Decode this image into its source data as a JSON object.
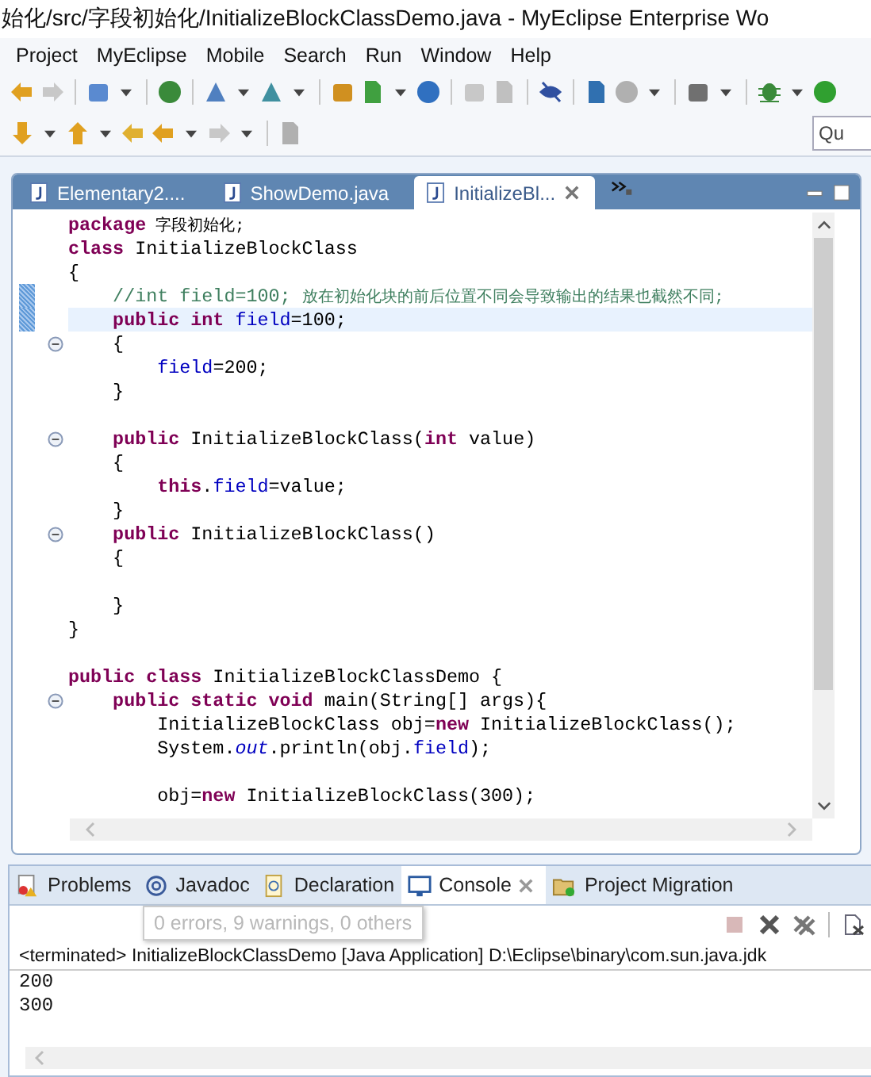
{
  "window": {
    "title": "始化/src/字段初始化/InitializeBlockClassDemo.java - MyEclipse Enterprise Wo"
  },
  "menu": [
    {
      "label": "Project"
    },
    {
      "label": "MyEclipse"
    },
    {
      "label": "Mobile"
    },
    {
      "label": "Search"
    },
    {
      "label": "Run"
    },
    {
      "label": "Window"
    },
    {
      "label": "Help"
    }
  ],
  "quick_access": {
    "placeholder": "Qu"
  },
  "editor": {
    "tabs": [
      {
        "label": "Elementary2....",
        "selected": false,
        "closable": false
      },
      {
        "label": "ShowDemo.java",
        "selected": false,
        "closable": false
      },
      {
        "label": "InitializeBl...",
        "selected": true,
        "closable": true
      }
    ],
    "lines": [
      {
        "current": false,
        "marked": false,
        "foldable": false,
        "tokens": [
          {
            "kind": "keyword",
            "text": "package"
          },
          {
            "kind": "cjk",
            "text": " 字段初始化;"
          }
        ]
      },
      {
        "current": false,
        "marked": false,
        "foldable": false,
        "tokens": [
          {
            "kind": "keyword",
            "text": "class"
          },
          {
            "kind": "plain",
            "text": " InitializeBlockClass"
          }
        ]
      },
      {
        "current": false,
        "marked": false,
        "foldable": false,
        "tokens": [
          {
            "kind": "plain",
            "text": "{"
          }
        ]
      },
      {
        "current": false,
        "marked": true,
        "foldable": false,
        "tokens": [
          {
            "kind": "comment",
            "text": "    //int field=100; "
          },
          {
            "kind": "comment_cjk",
            "text": "放在初始化块的前后位置不同会导致输出的结果也截然不同;"
          }
        ]
      },
      {
        "current": true,
        "marked": true,
        "foldable": false,
        "tokens": [
          {
            "kind": "keyword",
            "text": "    public int "
          },
          {
            "kind": "field",
            "text": "field"
          },
          {
            "kind": "plain",
            "text": "=100;"
          }
        ]
      },
      {
        "current": false,
        "marked": false,
        "foldable": true,
        "tokens": [
          {
            "kind": "plain",
            "text": "    {"
          }
        ]
      },
      {
        "current": false,
        "marked": false,
        "foldable": false,
        "tokens": [
          {
            "kind": "field",
            "text": "        field"
          },
          {
            "kind": "plain",
            "text": "=200;"
          }
        ]
      },
      {
        "current": false,
        "marked": false,
        "foldable": false,
        "tokens": [
          {
            "kind": "plain",
            "text": "    }"
          }
        ]
      },
      {
        "current": false,
        "marked": false,
        "foldable": false
      },
      {
        "current": false,
        "marked": false,
        "foldable": true,
        "tokens": [
          {
            "kind": "keyword",
            "text": "    public"
          },
          {
            "kind": "plain",
            "text": " InitializeBlockClass("
          },
          {
            "kind": "keyword",
            "text": "int"
          },
          {
            "kind": "plain",
            "text": " value)"
          }
        ]
      },
      {
        "current": false,
        "marked": false,
        "foldable": false,
        "tokens": [
          {
            "kind": "plain",
            "text": "    {"
          }
        ]
      },
      {
        "current": false,
        "marked": false,
        "foldable": false,
        "tokens": [
          {
            "kind": "keyword",
            "text": "        this"
          },
          {
            "kind": "plain",
            "text": "."
          },
          {
            "kind": "field",
            "text": "field"
          },
          {
            "kind": "plain",
            "text": "=value;"
          }
        ]
      },
      {
        "current": false,
        "marked": false,
        "foldable": false,
        "tokens": [
          {
            "kind": "plain",
            "text": "    }"
          }
        ]
      },
      {
        "current": false,
        "marked": false,
        "foldable": true,
        "tokens": [
          {
            "kind": "keyword",
            "text": "    public"
          },
          {
            "kind": "plain",
            "text": " InitializeBlockClass()"
          }
        ]
      },
      {
        "current": false,
        "marked": false,
        "foldable": false,
        "tokens": [
          {
            "kind": "plain",
            "text": "    {"
          }
        ]
      },
      {
        "current": false,
        "marked": false,
        "foldable": false
      },
      {
        "current": false,
        "marked": false,
        "foldable": false,
        "tokens": [
          {
            "kind": "plain",
            "text": "    }"
          }
        ]
      },
      {
        "current": false,
        "marked": false,
        "foldable": false,
        "tokens": [
          {
            "kind": "plain",
            "text": "}"
          }
        ]
      },
      {
        "current": false,
        "marked": false,
        "foldable": false
      },
      {
        "current": false,
        "marked": false,
        "foldable": false,
        "tokens": [
          {
            "kind": "keyword",
            "text": "public class"
          },
          {
            "kind": "plain",
            "text": " InitializeBlockClassDemo {"
          }
        ]
      },
      {
        "current": false,
        "marked": false,
        "foldable": true,
        "tokens": [
          {
            "kind": "keyword",
            "text": "    public static void"
          },
          {
            "kind": "plain",
            "text": " main(String[] args){"
          }
        ]
      },
      {
        "current": false,
        "marked": false,
        "foldable": false,
        "tokens": [
          {
            "kind": "plain",
            "text": "        InitializeBlockClass obj="
          },
          {
            "kind": "keyword",
            "text": "new"
          },
          {
            "kind": "plain",
            "text": " InitializeBlockClass();"
          }
        ]
      },
      {
        "current": false,
        "marked": false,
        "foldable": false,
        "tokens": [
          {
            "kind": "plain",
            "text": "        System."
          },
          {
            "kind": "static",
            "text": "out"
          },
          {
            "kind": "plain",
            "text": ".println(obj."
          },
          {
            "kind": "field",
            "text": "field"
          },
          {
            "kind": "plain",
            "text": ");"
          }
        ]
      },
      {
        "current": false,
        "marked": false,
        "foldable": false
      },
      {
        "current": false,
        "marked": false,
        "foldable": false,
        "tokens": [
          {
            "kind": "plain",
            "text": "        obj="
          },
          {
            "kind": "keyword",
            "text": "new"
          },
          {
            "kind": "plain",
            "text": " InitializeBlockClass(300);"
          }
        ]
      }
    ]
  },
  "bottom_panel": {
    "tabs": [
      {
        "label": "Problems",
        "selected": false,
        "closable": false
      },
      {
        "label": "Javadoc",
        "selected": false,
        "closable": false
      },
      {
        "label": "Declaration",
        "selected": false,
        "closable": false
      },
      {
        "label": "Console",
        "selected": true,
        "closable": true
      },
      {
        "label": "Project Migration",
        "selected": false,
        "closable": false
      }
    ],
    "tooltip": "0 errors, 9 warnings, 0 others",
    "console": {
      "header": "<terminated> InitializeBlockClassDemo [Java Application] D:\\Eclipse\\binary\\com.sun.java.jdk",
      "output": [
        "200",
        "300"
      ]
    }
  }
}
